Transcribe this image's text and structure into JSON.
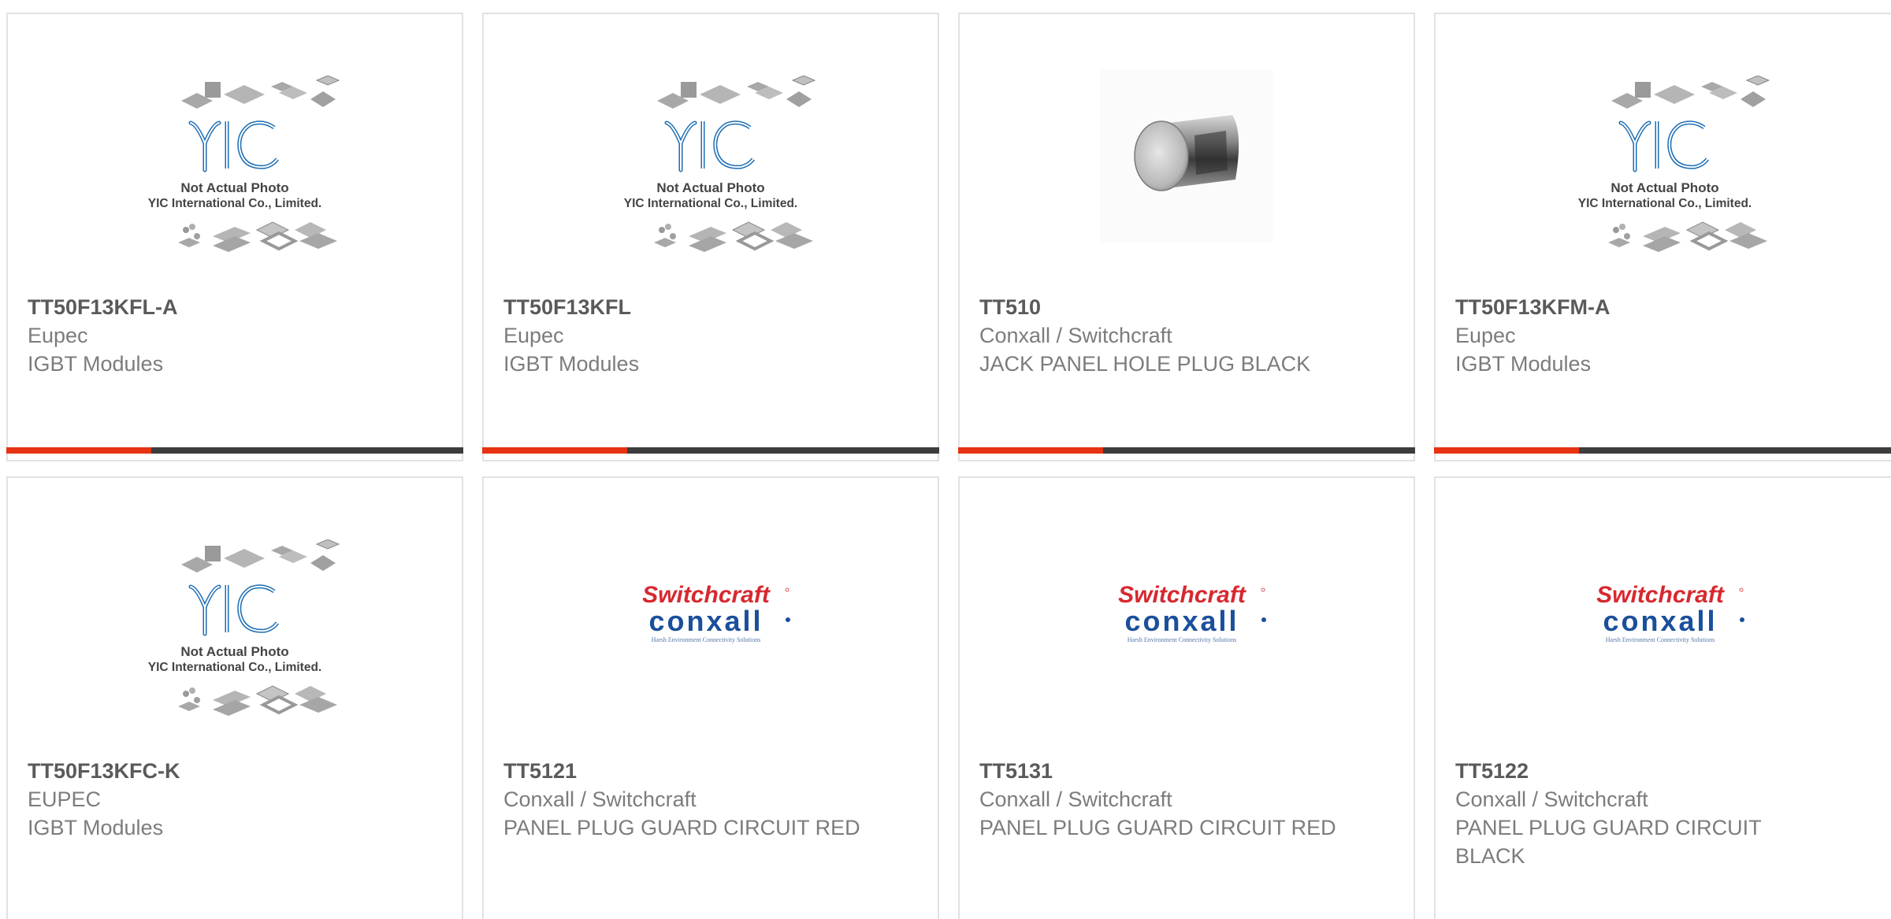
{
  "placeholder": {
    "line1": "Not Actual Photo",
    "line2": "YIC International Co., Limited.",
    "brand": "YIC"
  },
  "logo": {
    "top": "Switchcraft",
    "bottom": "conxall",
    "tagline": "Harsh Environment Connectivity Solutions"
  },
  "colors": {
    "accent": "#e63312",
    "bar": "#3d3d3d",
    "border": "#e2e2e2",
    "switchcraft_red": "#d7282f",
    "conxall_blue": "#1a4f9c",
    "yic_blue": "#1c6db4"
  },
  "products": [
    {
      "pn": "TT50F13KFL-A",
      "mfr": "Eupec",
      "desc": "IGBT Modules",
      "image": "placeholder",
      "has_bar": true
    },
    {
      "pn": "TT50F13KFL",
      "mfr": "Eupec",
      "desc": "IGBT Modules",
      "image": "placeholder",
      "has_bar": true
    },
    {
      "pn": "TT510",
      "mfr": "Conxall / Switchcraft",
      "desc": "JACK PANEL HOLE PLUG BLACK",
      "image": "plug-photo",
      "has_bar": true
    },
    {
      "pn": "TT50F13KFM-A",
      "mfr": "Eupec",
      "desc": "IGBT Modules",
      "image": "placeholder",
      "has_bar": true
    },
    {
      "pn": "TT50F13KFC-K",
      "mfr": "EUPEC",
      "desc": "IGBT Modules",
      "image": "placeholder",
      "has_bar": false
    },
    {
      "pn": "TT5121",
      "mfr": "Conxall / Switchcraft",
      "desc": "PANEL PLUG GUARD CIRCUIT RED",
      "image": "switchcraft-logo",
      "has_bar": false
    },
    {
      "pn": "TT5131",
      "mfr": "Conxall / Switchcraft",
      "desc": "PANEL PLUG GUARD CIRCUIT RED",
      "image": "switchcraft-logo",
      "has_bar": false
    },
    {
      "pn": "TT5122",
      "mfr": "Conxall / Switchcraft",
      "desc": "PANEL PLUG GUARD CIRCUIT BLACK",
      "image": "switchcraft-logo",
      "has_bar": false
    }
  ]
}
